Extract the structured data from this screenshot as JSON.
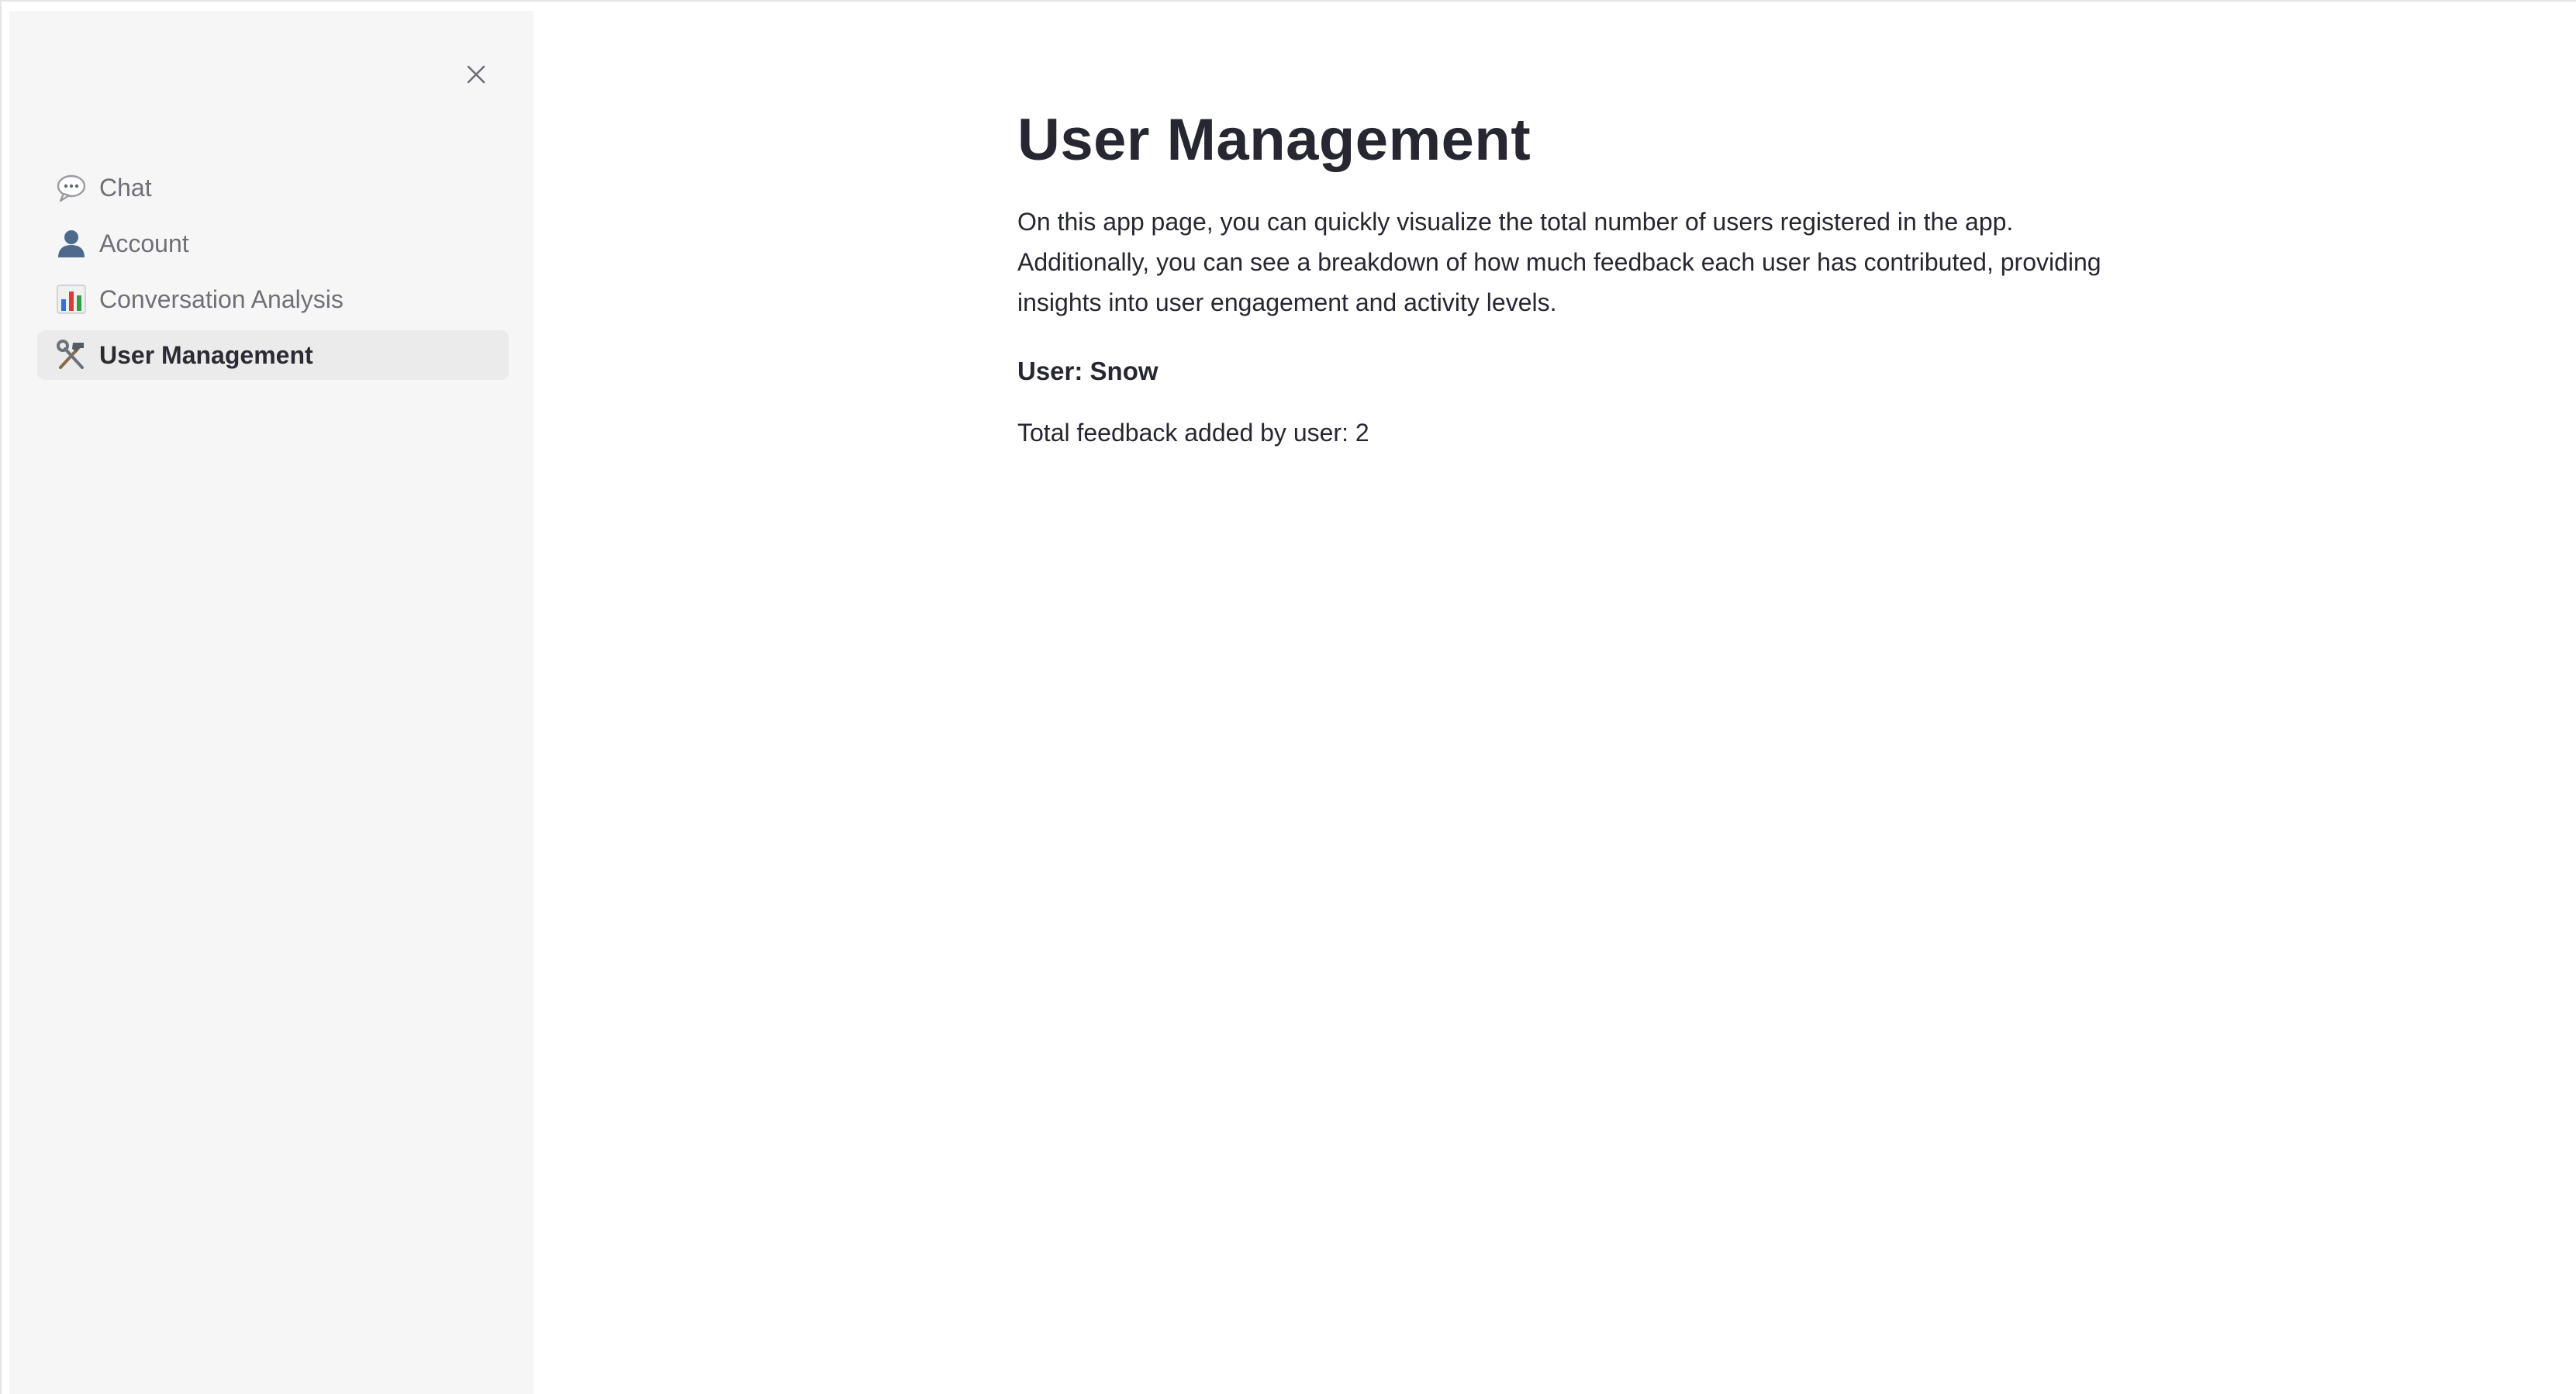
{
  "sidebar": {
    "close_icon": "close-icon",
    "items": [
      {
        "icon": "speech-bubble-icon",
        "label": "Chat",
        "active": false
      },
      {
        "icon": "user-silhouette-icon",
        "label": "Account",
        "active": false
      },
      {
        "icon": "bar-chart-icon",
        "label": "Conversation Analysis",
        "active": false
      },
      {
        "icon": "hammer-wrench-icon",
        "label": "User Management",
        "active": true
      }
    ]
  },
  "main": {
    "title": "User Management",
    "description": "On this app page, you can quickly visualize the total number of users registered in the app. Additionally, you can see a breakdown of how much feedback each user has contributed, providing insights into user engagement and activity levels.",
    "user_label": "User: Snow",
    "feedback_text": "Total feedback added by user: 2"
  },
  "colors": {
    "sidebar_bg": "#f6f6f6",
    "active_item_bg": "#ebebeb",
    "text_primary": "#262730",
    "text_muted": "#6f6f78"
  }
}
